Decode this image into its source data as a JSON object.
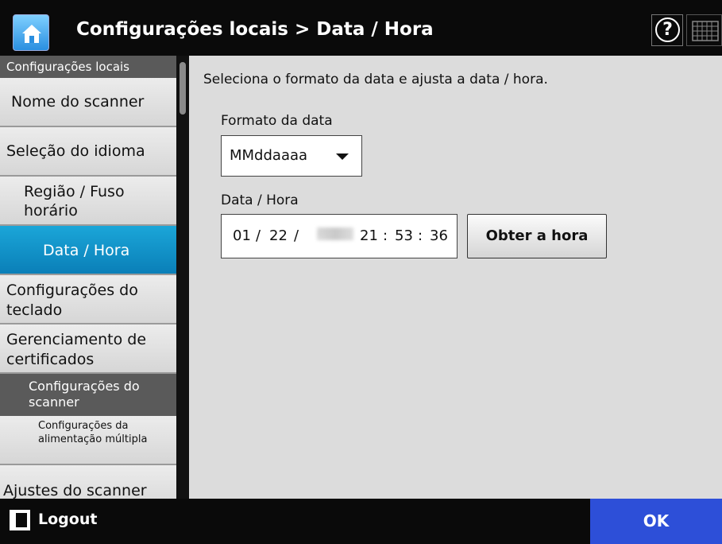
{
  "header": {
    "title": "Configurações locais > Data / Hora",
    "home_icon": "home-icon",
    "help_icon": "help-icon",
    "keyboard_icon": "keyboard-icon"
  },
  "sidebar": {
    "category_1": "Configurações locais",
    "items": [
      "Nome do scanner",
      "Seleção do idioma",
      "Região / Fuso horário",
      "Data / Hora",
      "Configurações do teclado",
      "Gerenciamento de certificados"
    ],
    "category_2": "Configurações do scanner",
    "sub_item": "Configurações da alimentação múltipla",
    "last_item": "Ajustes do scanner",
    "active_item": "Data / Hora"
  },
  "main": {
    "description": "Seleciona o formato da data e ajusta a data / hora.",
    "date_format_label": "Formato da data",
    "date_format_value": "MMddaaaa",
    "datetime_label": "Data / Hora",
    "datetime": {
      "month": "01",
      "day": "22",
      "year": "2015",
      "hour": "21",
      "minute": "53",
      "second": "36"
    },
    "get_time_button": "Obter a hora"
  },
  "footer": {
    "logout_label": "Logout",
    "ok_label": "OK"
  },
  "colors": {
    "active_item": "#1ba6d8",
    "ok_button": "#2d4fd8"
  }
}
